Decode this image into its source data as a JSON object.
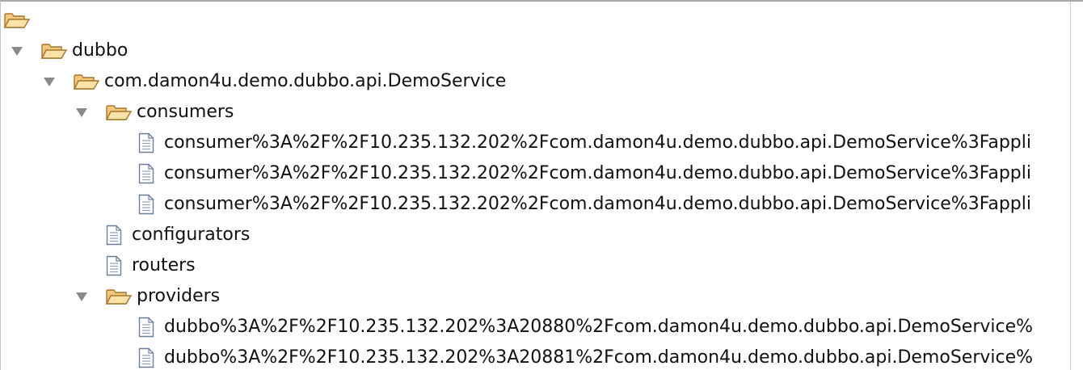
{
  "tree": {
    "nodes": [
      {
        "label": "",
        "icon": "folder-open-icon",
        "depth": 0,
        "twisty": "none"
      },
      {
        "label": "dubbo",
        "icon": "folder-open-icon",
        "depth": 1,
        "twisty": "expanded"
      },
      {
        "label": "com.damon4u.demo.dubbo.api.DemoService",
        "icon": "folder-open-icon",
        "depth": 2,
        "twisty": "expanded"
      },
      {
        "label": "consumers",
        "icon": "folder-open-icon",
        "depth": 3,
        "twisty": "expanded"
      },
      {
        "label": "consumer%3A%2F%2F10.235.132.202%2Fcom.damon4u.demo.dubbo.api.DemoService%3Fappli",
        "icon": "document-icon",
        "depth": 4,
        "twisty": "none"
      },
      {
        "label": "consumer%3A%2F%2F10.235.132.202%2Fcom.damon4u.demo.dubbo.api.DemoService%3Fappli",
        "icon": "document-icon",
        "depth": 4,
        "twisty": "none"
      },
      {
        "label": "consumer%3A%2F%2F10.235.132.202%2Fcom.damon4u.demo.dubbo.api.DemoService%3Fappli",
        "icon": "document-icon",
        "depth": 4,
        "twisty": "none"
      },
      {
        "label": "configurators",
        "icon": "document-icon",
        "depth": 3,
        "twisty": "none"
      },
      {
        "label": "routers",
        "icon": "document-icon",
        "depth": 3,
        "twisty": "none"
      },
      {
        "label": "providers",
        "icon": "folder-open-icon",
        "depth": 3,
        "twisty": "expanded"
      },
      {
        "label": "dubbo%3A%2F%2F10.235.132.202%3A20880%2Fcom.damon4u.demo.dubbo.api.DemoService%",
        "icon": "document-icon",
        "depth": 4,
        "twisty": "none"
      },
      {
        "label": "dubbo%3A%2F%2F10.235.132.202%3A20881%2Fcom.damon4u.demo.dubbo.api.DemoService%",
        "icon": "document-icon",
        "depth": 4,
        "twisty": "none"
      }
    ]
  },
  "colors": {
    "folder_fill": "#f7d58c",
    "folder_stroke": "#b9882a",
    "document_stroke": "#6a7fa0",
    "twisty": "#8a8a8a",
    "text": "#111111"
  }
}
